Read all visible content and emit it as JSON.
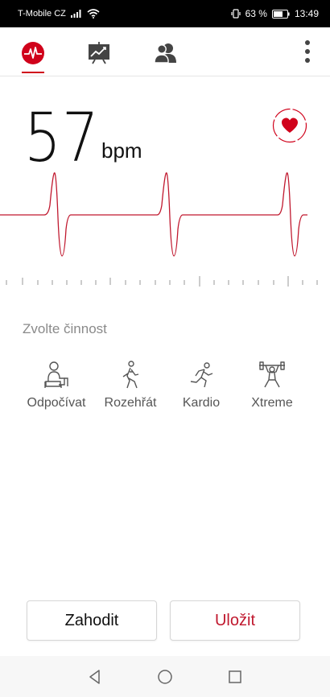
{
  "status_bar": {
    "carrier": "T-Mobile CZ",
    "battery": "63 %",
    "time": "13:49"
  },
  "tabs": [
    {
      "name": "heart-rate",
      "active": true
    },
    {
      "name": "history",
      "active": false
    },
    {
      "name": "community",
      "active": false
    }
  ],
  "measurement": {
    "value": "57",
    "unit": "bpm"
  },
  "activity": {
    "title": "Zvolte činnost",
    "items": [
      {
        "label": "Odpočívat",
        "icon": "resting-person-icon"
      },
      {
        "label": "Rozehřát",
        "icon": "walking-person-icon"
      },
      {
        "label": "Kardio",
        "icon": "running-person-icon"
      },
      {
        "label": "Xtreme",
        "icon": "weightlifter-icon"
      }
    ]
  },
  "actions": {
    "discard_label": "Zahodit",
    "save_label": "Uložit"
  },
  "colors": {
    "accent": "#d0021b",
    "save_text": "#c0182e"
  }
}
